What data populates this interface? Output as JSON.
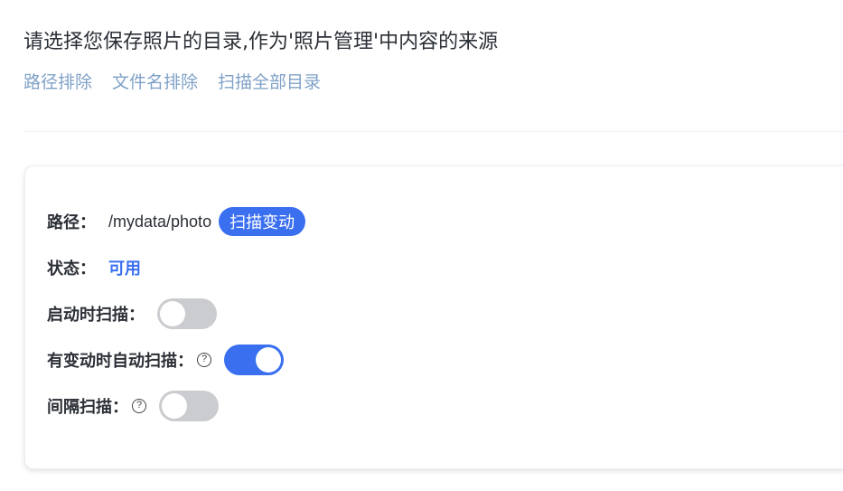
{
  "header": {
    "title": "请选择您保存照片的目录,作为'照片管理'中内容的来源",
    "links": [
      "路径排除",
      "文件名排除",
      "扫描全部目录"
    ]
  },
  "card": {
    "path": {
      "label": "路径",
      "colon": "：",
      "value": "/mydata/photo",
      "button_label": "扫描变动"
    },
    "status": {
      "label": "状态",
      "colon": "：",
      "value": "可用"
    },
    "scan_on_start": {
      "label": "启动时扫描",
      "colon": "：",
      "enabled": false
    },
    "auto_scan_on_change": {
      "label": "有变动时自动扫描",
      "colon": "：",
      "help_icon": "question-circle-icon",
      "enabled": true
    },
    "interval_scan": {
      "label": "间隔扫描",
      "colon": "：",
      "help_icon": "question-circle-icon",
      "enabled": false
    }
  },
  "colors": {
    "accent": "#3a6ff0",
    "link": "#7fa1c7",
    "toggle_off": "#cbcccf"
  }
}
